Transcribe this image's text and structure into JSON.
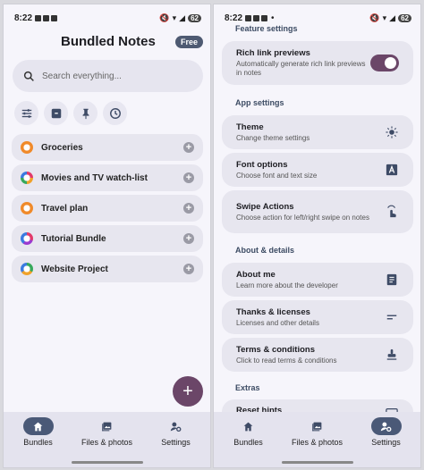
{
  "status": {
    "time": "8:22",
    "battery": "62"
  },
  "left": {
    "title": "Bundled Notes",
    "badge": "Free",
    "search_placeholder": "Search everything...",
    "filters": [
      "filter-sliders-icon",
      "archive-icon",
      "pin-icon",
      "clock-icon"
    ],
    "bundles": [
      {
        "label": "Groceries",
        "color": "#f08a2a"
      },
      {
        "label": "Movies and TV watch-list",
        "color": "multi"
      },
      {
        "label": "Travel plan",
        "color": "#f08a2a"
      },
      {
        "label": "Tutorial Bundle",
        "color": "multi2"
      },
      {
        "label": "Website Project",
        "color": "multi3"
      }
    ],
    "fab": "+"
  },
  "nav": {
    "bundles": "Bundles",
    "files": "Files & photos",
    "settings": "Settings"
  },
  "right": {
    "feature_section": "Feature settings",
    "rich_title": "Rich link previews",
    "rich_sub": "Automatically generate rich link previews in notes",
    "rich_enabled": true,
    "app_section": "App settings",
    "theme_title": "Theme",
    "theme_sub": "Change theme settings",
    "font_title": "Font options",
    "font_sub": "Choose font and text size",
    "swipe_title": "Swipe Actions",
    "swipe_sub": "Choose action for left/right swipe on notes",
    "about_section": "About & details",
    "about_title": "About me",
    "about_sub": "Learn more about the developer",
    "thanks_title": "Thanks & licenses",
    "thanks_sub": "Licenses and other details",
    "terms_title": "Terms & conditions",
    "terms_sub": "Click to read terms & conditions",
    "extras_section": "Extras",
    "hints_title": "Reset hints"
  },
  "colors": {
    "accent": "#6b4668",
    "nav_active": "#4a5977",
    "surface": "#e7e6ef"
  }
}
